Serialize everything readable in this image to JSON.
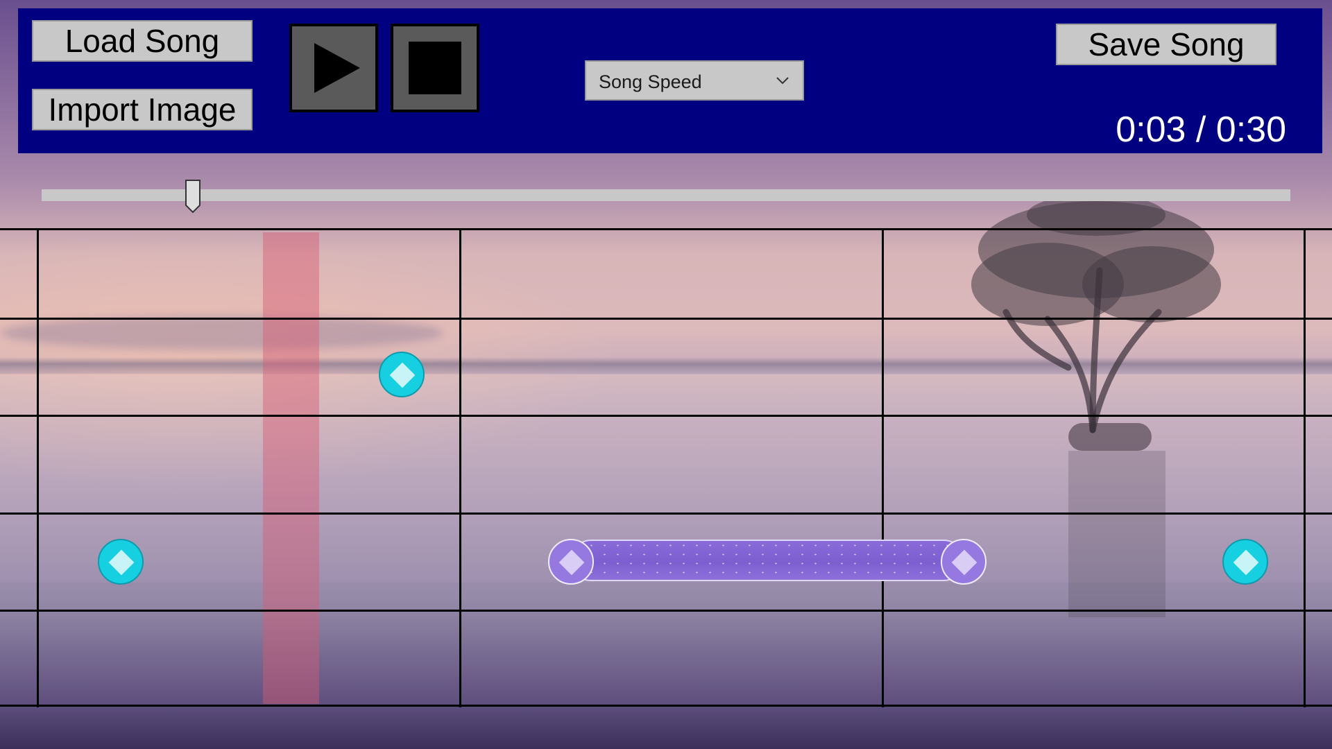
{
  "toolbar": {
    "load_song": "Load Song",
    "import_image": "Import Image",
    "save_song": "Save Song",
    "play_icon": "play-icon",
    "stop_icon": "stop-icon",
    "speed_dropdown": {
      "selected": "Song Speed"
    },
    "time_display": "0:03 / 0:30"
  },
  "timeline": {
    "position_fraction": 0.1
  },
  "colors": {
    "panel": "#000080",
    "button": "#c8c8c8",
    "note_tap": "#16cfe0",
    "note_hold": "#9579e0",
    "playhead": "#d75a73"
  },
  "notes": [
    {
      "type": "tap",
      "color": "cyan"
    },
    {
      "type": "tap",
      "color": "cyan"
    },
    {
      "type": "hold",
      "color": "purple"
    },
    {
      "type": "tap",
      "color": "cyan"
    }
  ]
}
